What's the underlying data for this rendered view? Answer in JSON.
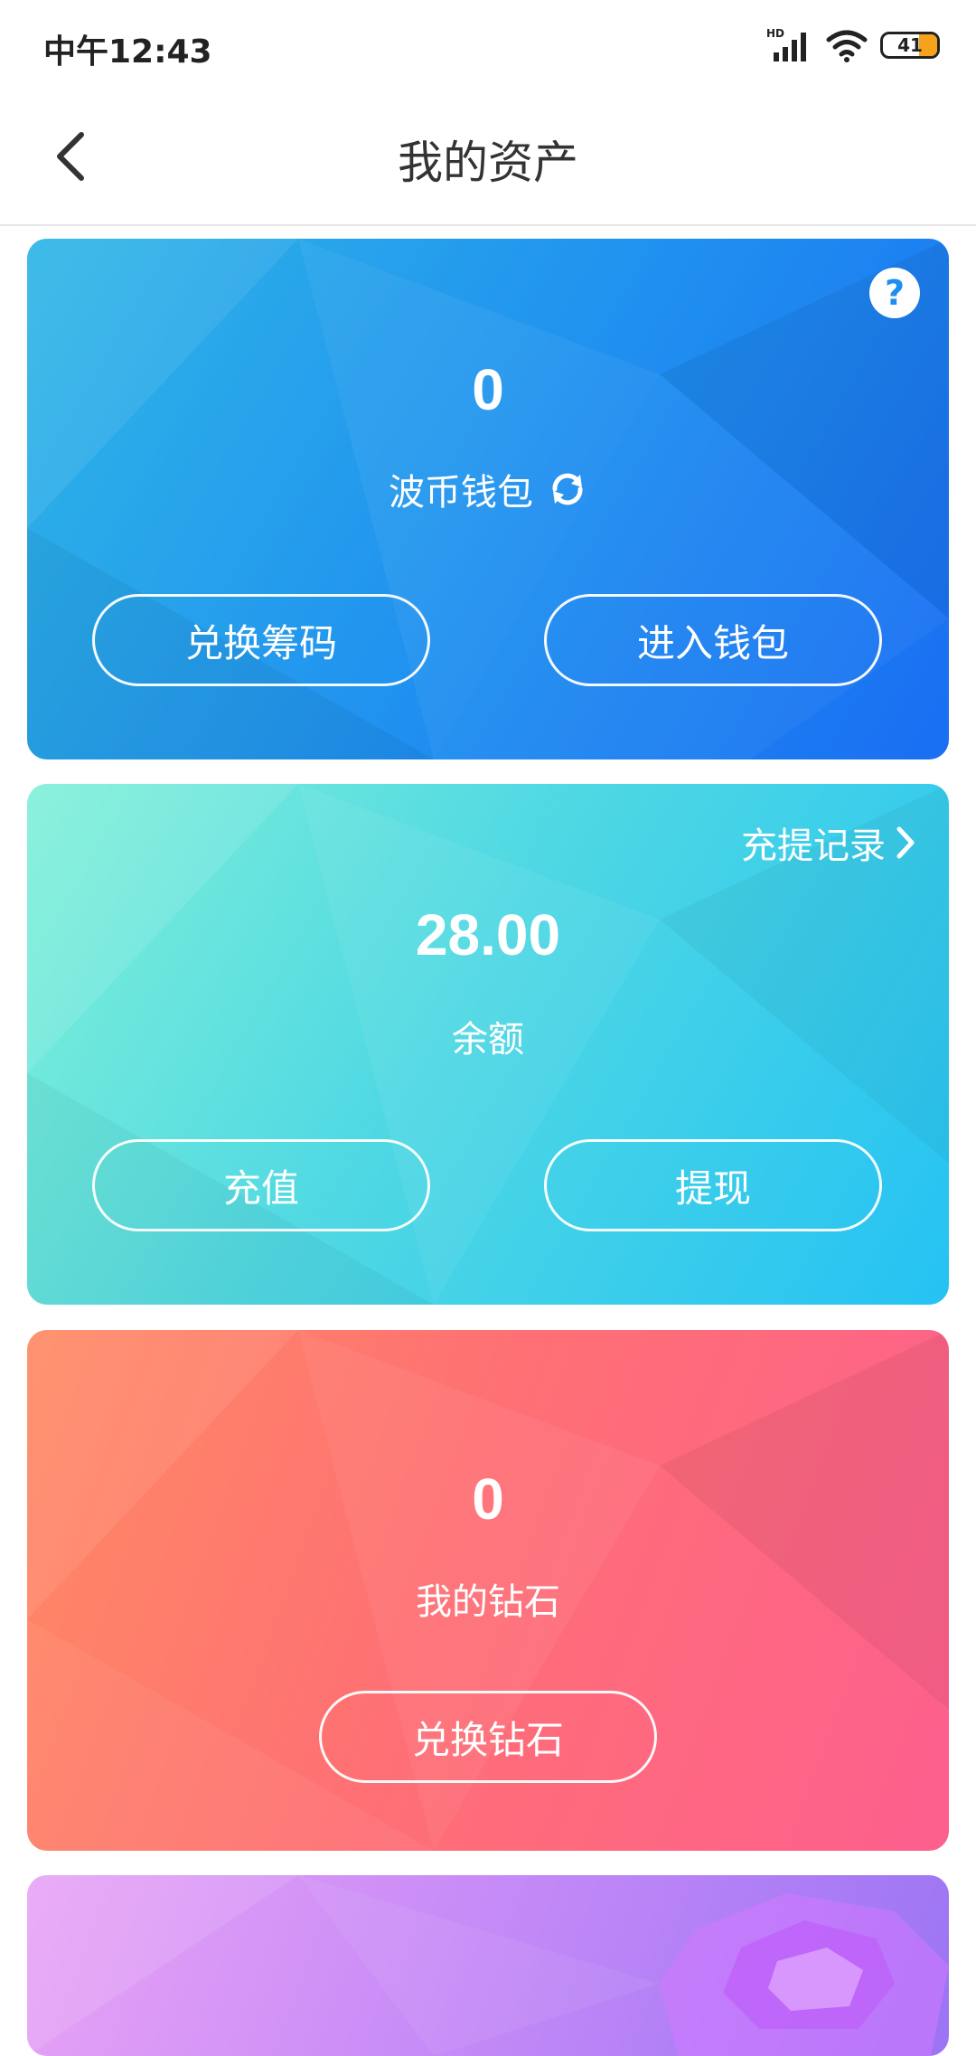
{
  "status_bar": {
    "time": "中午12:43",
    "battery": "41",
    "hd_label": "HD"
  },
  "header": {
    "title": "我的资产"
  },
  "wallet_card": {
    "amount": "0",
    "label": "波币钱包",
    "exchange_button": "兑换筹码",
    "enter_button": "进入钱包"
  },
  "balance_card": {
    "records_link": "充提记录",
    "amount": "28.00",
    "label": "余额",
    "recharge_button": "充值",
    "withdraw_button": "提现"
  },
  "diamond_card": {
    "amount": "0",
    "label": "我的钻石",
    "exchange_button": "兑换钻石"
  },
  "colors": {
    "wallet_gradient": [
      "#2fb6e6",
      "#1a6ef2"
    ],
    "balance_gradient": [
      "#7ff0d8",
      "#25c2f3"
    ],
    "diamond_gradient": [
      "#ff8a63",
      "#fd5f8e"
    ],
    "gem_gradient": [
      "#e8a3f5",
      "#9b74f4"
    ]
  },
  "icons": [
    "back-arrow-icon",
    "help-icon",
    "refresh-icon",
    "chevron-right-icon",
    "signal-icon",
    "wifi-icon",
    "battery-icon",
    "gem-icon"
  ]
}
